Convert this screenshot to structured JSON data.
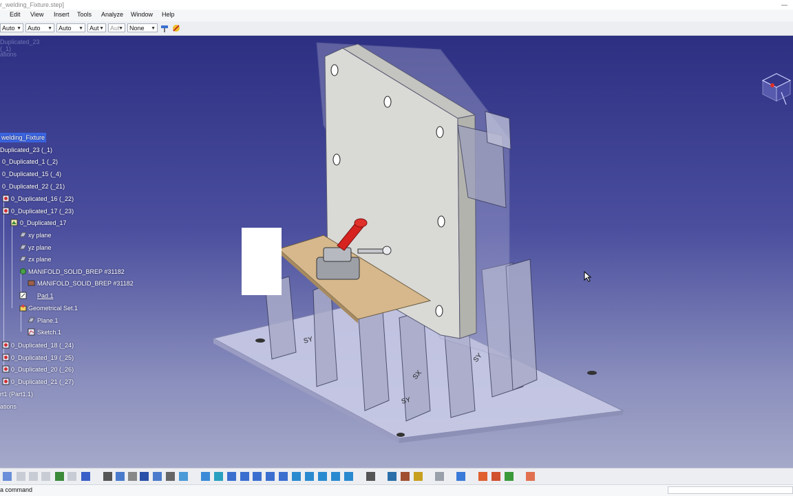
{
  "window": {
    "title": "r_welding_Fixture.step]"
  },
  "menu": [
    "Edit",
    "View",
    "Insert",
    "Tools",
    "Analyze",
    "Window",
    "Help"
  ],
  "toolbar": {
    "combos": [
      {
        "value": "Auto",
        "disabled": false
      },
      {
        "value": "Auto",
        "disabled": false
      },
      {
        "value": "Auto",
        "disabled": false
      },
      {
        "value": "Aut",
        "disabled": false
      },
      {
        "value": "Aut",
        "disabled": true
      },
      {
        "value": "None",
        "disabled": false
      }
    ]
  },
  "tree": {
    "ghost_top": [
      "Duplicated_23 (_1)",
      "ations"
    ],
    "nodes": [
      {
        "label": "welding_Fixture",
        "selected": true
      },
      {
        "label": "Duplicated_23 (_1)"
      },
      {
        "label": "0_Duplicated_1 (_2)"
      },
      {
        "label": "0_Duplicated_15 (_4)"
      },
      {
        "label": "0_Duplicated_22 (_21)"
      },
      {
        "label": "0_Duplicated_16 (_22)"
      },
      {
        "label": "0_Duplicated_17 (_23)"
      },
      {
        "label": "0_Duplicated_17"
      },
      {
        "label": "xy plane"
      },
      {
        "label": "yz plane"
      },
      {
        "label": "zx plane"
      },
      {
        "label": "MANIFOLD_SOLID_BREP #31182"
      },
      {
        "label": "MANIFOLD_SOLID_BREP #31182"
      },
      {
        "label": "Pad.1"
      },
      {
        "label": "Geometrical Set.1"
      },
      {
        "label": "Plane.1"
      },
      {
        "label": "Sketch.1"
      },
      {
        "label": "0_Duplicated_18 (_24)"
      },
      {
        "label": "0_Duplicated_19 (_25)"
      },
      {
        "label": "0_Duplicated_20 (_26)"
      },
      {
        "label": "0_Duplicated_21 (_27)"
      },
      {
        "label": "rt1 (Part1.1)"
      },
      {
        "label": "ations"
      }
    ]
  },
  "model": {
    "engraving_labels": [
      "SY",
      "SY",
      "SX",
      "SY"
    ]
  },
  "status": {
    "prompt": "a command"
  }
}
